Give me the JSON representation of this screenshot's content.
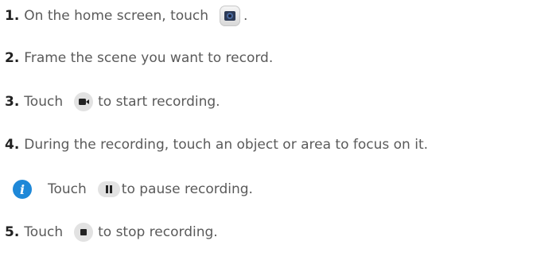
{
  "steps": [
    {
      "num": "1.",
      "text_before": "On the home screen, touch",
      "text_after": ".",
      "icon": "camera-app-icon"
    },
    {
      "num": "2.",
      "text": "Frame the scene you want to record."
    },
    {
      "num": "3.",
      "text_before": "Touch",
      "text_after": "to start recording.",
      "icon": "video-record-icon"
    },
    {
      "num": "4.",
      "text": "During the recording, touch an object or area to focus on it."
    },
    {
      "num": "5.",
      "text_before": "Touch",
      "text_after": "to stop recording.",
      "icon": "stop-icon"
    }
  ],
  "note": {
    "icon": "info-icon",
    "text_before": "Touch",
    "text_after": "to pause recording.",
    "inline_icon": "pause-icon"
  },
  "colors": {
    "text": "#5a5a5a",
    "number": "#222222",
    "info_blue": "#1e88d8",
    "icon_gray": "#e2e2e2"
  }
}
